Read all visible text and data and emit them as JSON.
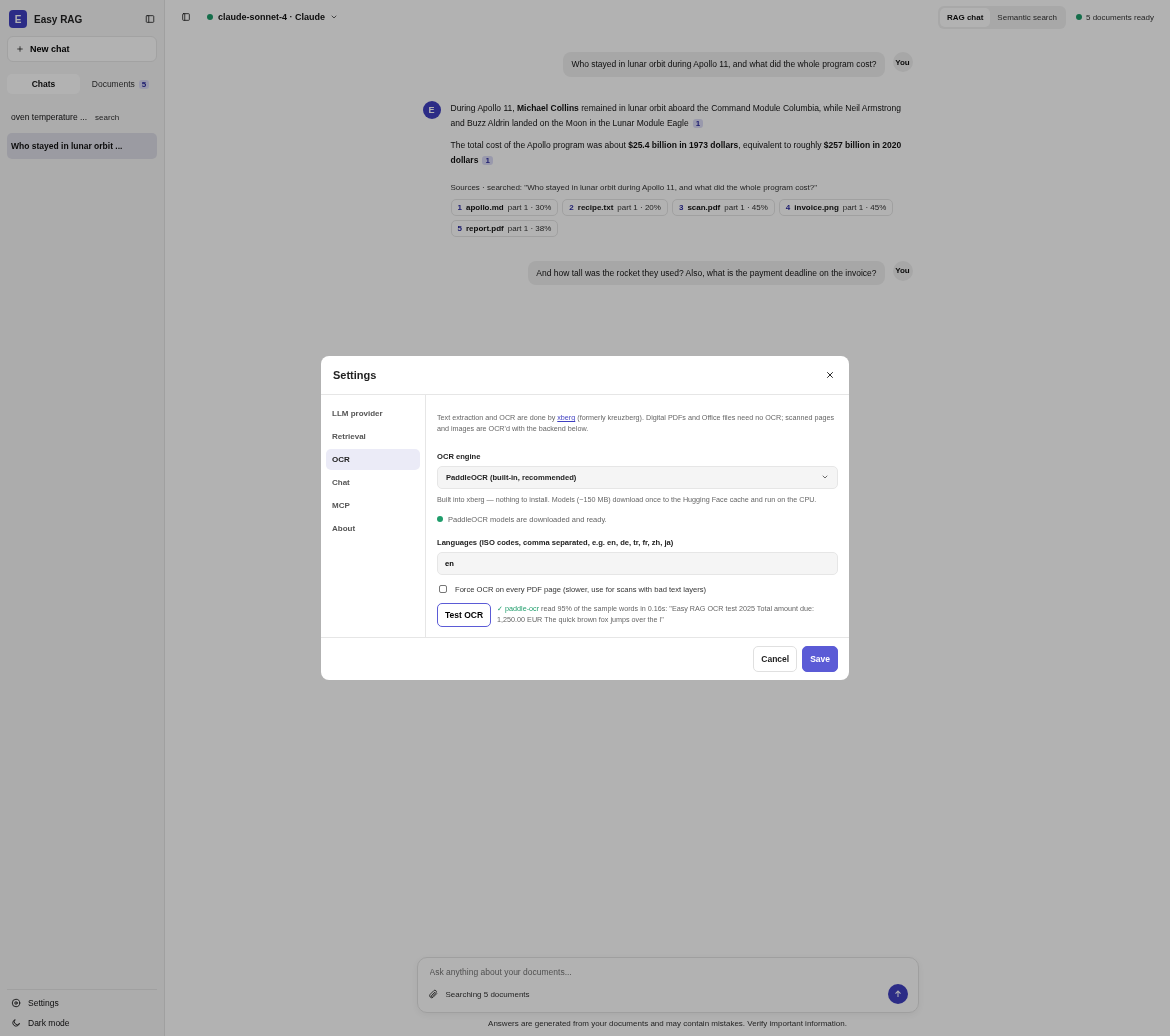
{
  "sidebar": {
    "app_name": "Easy RAG",
    "logo_letter": "E",
    "new_chat": "New chat",
    "tabs": [
      {
        "label": "Chats",
        "selected": true
      },
      {
        "label": "Documents",
        "selected": false,
        "badge": "5"
      }
    ],
    "chats": [
      {
        "title": "oven temperature ...",
        "tag": "search",
        "selected": false
      },
      {
        "title": "Who stayed in lunar orbit ...",
        "selected": true
      }
    ],
    "footer": [
      {
        "kind": "settings",
        "label": "Settings"
      },
      {
        "kind": "moon",
        "label": "Dark mode"
      }
    ]
  },
  "topbar": {
    "model": "claude-sonnet-4 · Claude",
    "modes": [
      {
        "label": "RAG chat",
        "selected": true
      },
      {
        "label": "Semantic search",
        "selected": false
      }
    ],
    "status": "5 documents ready"
  },
  "messages": [
    {
      "kind": "user",
      "avatar": "You",
      "text": "Who stayed in lunar orbit during Apollo 11, and what did the whole program cost?"
    },
    {
      "kind": "assistant",
      "avatar": "E",
      "paragraphs": [
        {
          "text": "During Apollo 11, **Michael Collins** remained in lunar orbit aboard the Command Module Columbia, while Neil Armstrong and Buzz Aldrin landed on the Moon in the Lunar Module Eagle",
          "cite": "1"
        },
        {
          "text": "The total cost of the Apollo program was about **$25.4 billion in 1973 dollars**, equivalent to roughly **$257 billion in 2020 dollars**",
          "cite": "1"
        }
      ],
      "sources_label": "Sources · searched: \"Who stayed in lunar orbit during Apollo 11, and what did the whole program cost?\"",
      "sources": [
        {
          "num": "1",
          "file": "apollo.md",
          "meta": "part 1 · 30%"
        },
        {
          "num": "2",
          "file": "recipe.txt",
          "meta": "part 1 · 20%"
        },
        {
          "num": "3",
          "file": "scan.pdf",
          "meta": "part 1 · 45%"
        },
        {
          "num": "4",
          "file": "invoice.png",
          "meta": "part 1 · 45%"
        },
        {
          "num": "5",
          "file": "report.pdf",
          "meta": "part 1 · 38%"
        }
      ]
    },
    {
      "kind": "user",
      "avatar": "You",
      "text": "And how tall was the rocket they used? Also, what is the payment deadline on the invoice?"
    }
  ],
  "composer": {
    "placeholder": "Ask anything about your documents...",
    "scope": "Searching 5 documents",
    "disclaimer": "Answers are generated from your documents and may contain mistakes. Verify important information."
  },
  "dialog": {
    "title": "Settings",
    "nav": [
      {
        "label": "LLM provider",
        "selected": false
      },
      {
        "label": "Retrieval",
        "selected": false
      },
      {
        "label": "OCR",
        "selected": true
      },
      {
        "label": "Chat",
        "selected": false
      },
      {
        "label": "MCP",
        "selected": false
      },
      {
        "label": "About",
        "selected": false
      }
    ],
    "intro": {
      "before": "Text extraction and OCR are done by",
      "link": "xberg",
      "after": "(formerly kreuzberg). Digital PDFs and Office files need no OCR; scanned pages and images are OCR'd with the backend below."
    },
    "engine_label": "OCR engine",
    "engine_value": "PaddleOCR (built-in, recommended)",
    "engine_help": "Built into xberg — nothing to install. Models (~150 MB) download once to the Hugging Face cache and run on the CPU.",
    "status": {
      "ok": true,
      "text": "PaddleOCR models are downloaded and ready."
    },
    "languages_label": "Languages (ISO codes, comma separated, e.g. en, de, tr, fr, zh, ja)",
    "languages_value": "en",
    "force_ocr": {
      "label": "Force OCR on every PDF page (slower, use for scans with bad text layers)",
      "checked": false
    },
    "test_button": "Test OCR",
    "test_result": {
      "ok": true,
      "engine": "✓ paddle-ocr",
      "text": "read 95% of the sample words in 0.16s: \"Easy RAG OCR test 2025 Total amount due: 1,250.00 EUR The quick brown fox jumps over the l\""
    },
    "buttons": [
      {
        "kind": "secondary",
        "label": "Cancel"
      },
      {
        "kind": "primary",
        "label": "Save"
      }
    ]
  }
}
